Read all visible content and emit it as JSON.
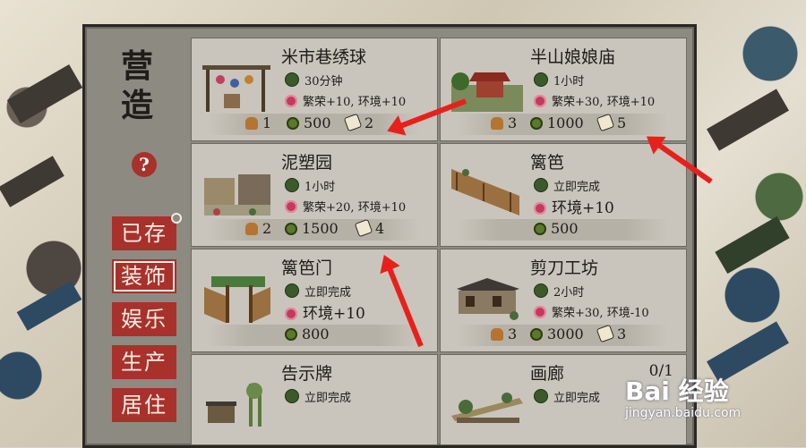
{
  "title": "营造",
  "help": "?",
  "nav": [
    {
      "label": "已存"
    },
    {
      "label": "装饰"
    },
    {
      "label": "娱乐"
    },
    {
      "label": "生产"
    },
    {
      "label": "居住"
    }
  ],
  "cards": [
    {
      "name": "米市巷绣球",
      "time": "30分钟",
      "effect": "繁荣+10, 环境+10",
      "workers": "1",
      "coins": "500",
      "tools": "2"
    },
    {
      "name": "半山娘娘庙",
      "time": "1小时",
      "effect": "繁荣+30, 环境+10",
      "workers": "3",
      "coins": "1000",
      "tools": "5"
    },
    {
      "name": "泥塑园",
      "time": "1小时",
      "effect": "繁荣+20, 环境+10",
      "workers": "2",
      "coins": "1500",
      "tools": "4"
    },
    {
      "name": "篱笆",
      "time": "立即完成",
      "effect": "环境+10",
      "coins": "500"
    },
    {
      "name": "篱笆门",
      "time": "立即完成",
      "effect": "环境+10",
      "coins": "800"
    },
    {
      "name": "剪刀工坊",
      "time": "2小时",
      "effect": "繁荣+30, 环境-10",
      "workers": "3",
      "coins": "3000",
      "tools": "3"
    },
    {
      "name": "告示牌",
      "time": "立即完成"
    },
    {
      "name": "画廊",
      "time": "立即完成",
      "count": "0/1"
    }
  ],
  "watermark": {
    "line1": "Bai 经验",
    "line2": "jingyan.baidu.com"
  },
  "colors": {
    "accent": "#a8312b",
    "arrow": "#e8201b",
    "panel": "#8d8a82",
    "card": "#c9c5bc"
  }
}
